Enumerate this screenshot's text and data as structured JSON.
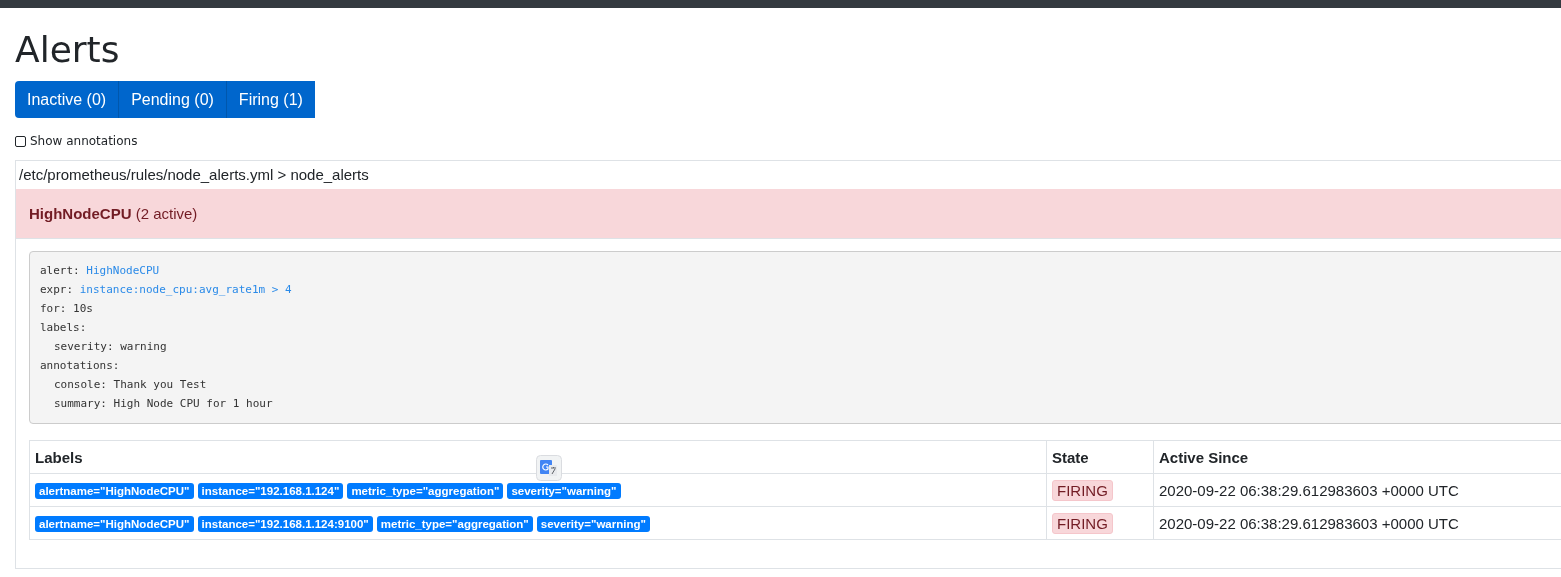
{
  "title": "Alerts",
  "tabs": [
    {
      "label": "Inactive (0)",
      "selected": false
    },
    {
      "label": "Pending (0)",
      "selected": false
    },
    {
      "label": "Firing (1)",
      "selected": false
    }
  ],
  "show_annotations": {
    "label": "Show annotations",
    "checked": false
  },
  "group": {
    "path": "/etc/prometheus/rules/node_alerts.yml > node_alerts",
    "rule": {
      "name": "HighNodeCPU",
      "count": "(2 active)",
      "definition": [
        {
          "key": "alert:",
          "value": "HighNodeCPU",
          "highlighted": true
        },
        {
          "key": "expr:",
          "value": "instance:node_cpu:avg_rate1m > 4",
          "highlighted": true
        },
        {
          "key": "for:",
          "value": "10s",
          "highlighted": false
        },
        {
          "key": "labels:",
          "children": [
            {
              "key": "severity:",
              "value": "warning",
              "highlighted": false
            }
          ]
        },
        {
          "key": "annotations:",
          "children": [
            {
              "key": "console:",
              "value": "Thank you Test",
              "highlighted": false
            },
            {
              "key": "summary:",
              "value": "High Node CPU for 1 hour",
              "highlighted": false
            }
          ]
        }
      ],
      "table": {
        "columns": [
          "Labels",
          "State",
          "Active Since"
        ],
        "rows": [
          {
            "labels": [
              "alertname=\"HighNodeCPU\"",
              "instance=\"192.168.1.124\"",
              "metric_type=\"aggregation\"",
              "severity=\"warning\""
            ],
            "state": "FIRING",
            "active_since": "2020-09-22 06:38:29.612983603 +0000 UTC"
          },
          {
            "labels": [
              "alertname=\"HighNodeCPU\"",
              "instance=\"192.168.1.124:9100\"",
              "metric_type=\"aggregation\"",
              "severity=\"warning\""
            ],
            "state": "FIRING",
            "active_since": "2020-09-22 06:38:29.612983603 +0000 UTC"
          }
        ]
      }
    }
  }
}
